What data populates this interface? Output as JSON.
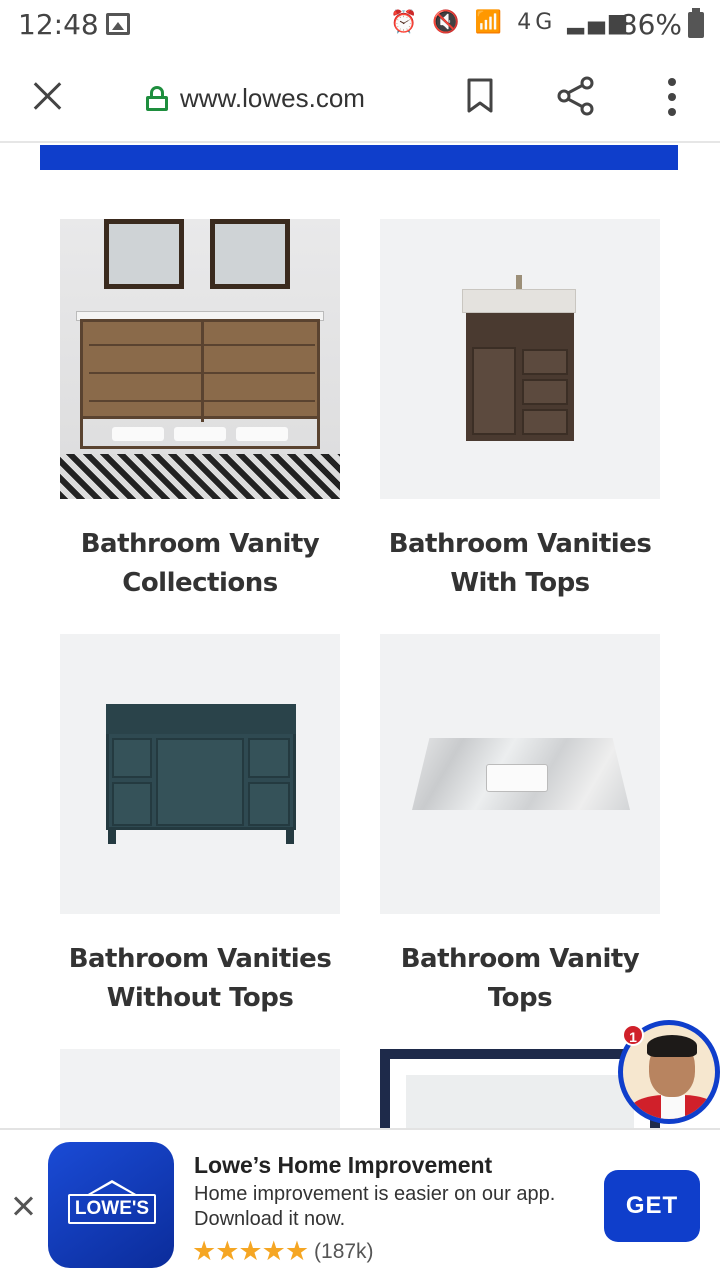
{
  "status_bar": {
    "time": "12:48",
    "indicators": "⏰ 🔇 📶 4G ▂▄▆",
    "battery": "86%"
  },
  "browser": {
    "url": "www.lowes.com",
    "icons": [
      "close-icon",
      "lock-icon",
      "bookmark-icon",
      "share-icon",
      "more-vert-icon"
    ]
  },
  "products": [
    {
      "title_line1": "Bathroom Vanity",
      "title_line2": "Collections"
    },
    {
      "title_line1": "Bathroom Vanities",
      "title_line2": "With Tops"
    },
    {
      "title_line1": "Bathroom Vanities",
      "title_line2": "Without Tops"
    },
    {
      "title_line1": "Bathroom Vanity Tops",
      "title_line2": ""
    }
  ],
  "chat": {
    "badge_count": "1"
  },
  "app_banner": {
    "app_name": "Lowe’s Home Improvement",
    "description": "Home improvement is easier on our app. Download it now.",
    "logo_text": "LOWE'S",
    "stars": "★★★★★",
    "rating_count": "(187k)",
    "get_label": "GET",
    "rating": 5
  },
  "colors": {
    "brand_blue": "#0f3ecb",
    "star": "#f5a623",
    "lock_green": "#1e8e3e"
  }
}
